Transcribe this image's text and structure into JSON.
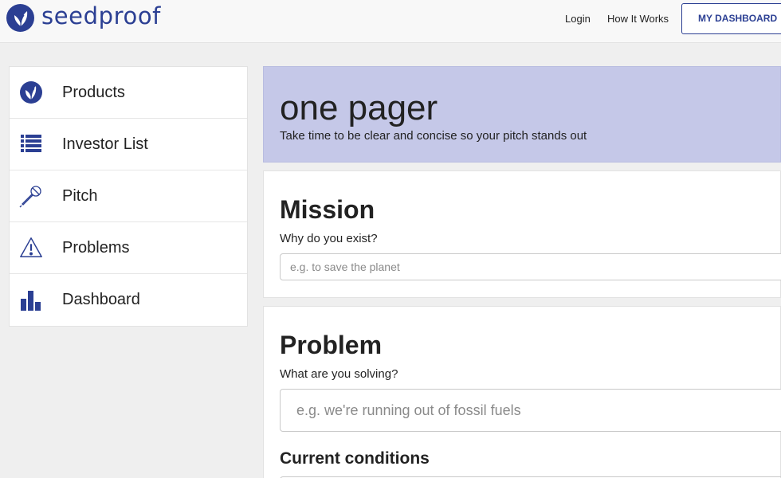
{
  "header": {
    "logo_text": "seedproof",
    "nav": {
      "login": "Login",
      "how_it_works": "How It Works"
    },
    "dashboard_button": "MY DASHBOARD"
  },
  "sidebar": {
    "items": [
      {
        "label": "Products",
        "icon": "leaf-icon"
      },
      {
        "label": "Investor List",
        "icon": "list-icon"
      },
      {
        "label": "Pitch",
        "icon": "microphone-icon"
      },
      {
        "label": "Problems",
        "icon": "warning-icon"
      },
      {
        "label": "Dashboard",
        "icon": "bar-chart-icon"
      }
    ]
  },
  "banner": {
    "title": "one pager",
    "subtitle": "Take time to be clear and concise so your pitch stands out"
  },
  "mission": {
    "heading": "Mission",
    "question": "Why do you exist?",
    "placeholder": "e.g. to save the planet"
  },
  "problem": {
    "heading": "Problem",
    "question": "What are you solving?",
    "placeholder": "e.g. we're running out of fossil fuels",
    "conditions_heading": "Current conditions"
  },
  "colors": {
    "brand": "#2b3f93",
    "banner_bg": "#c5c8e8",
    "page_bg": "#efefef"
  }
}
